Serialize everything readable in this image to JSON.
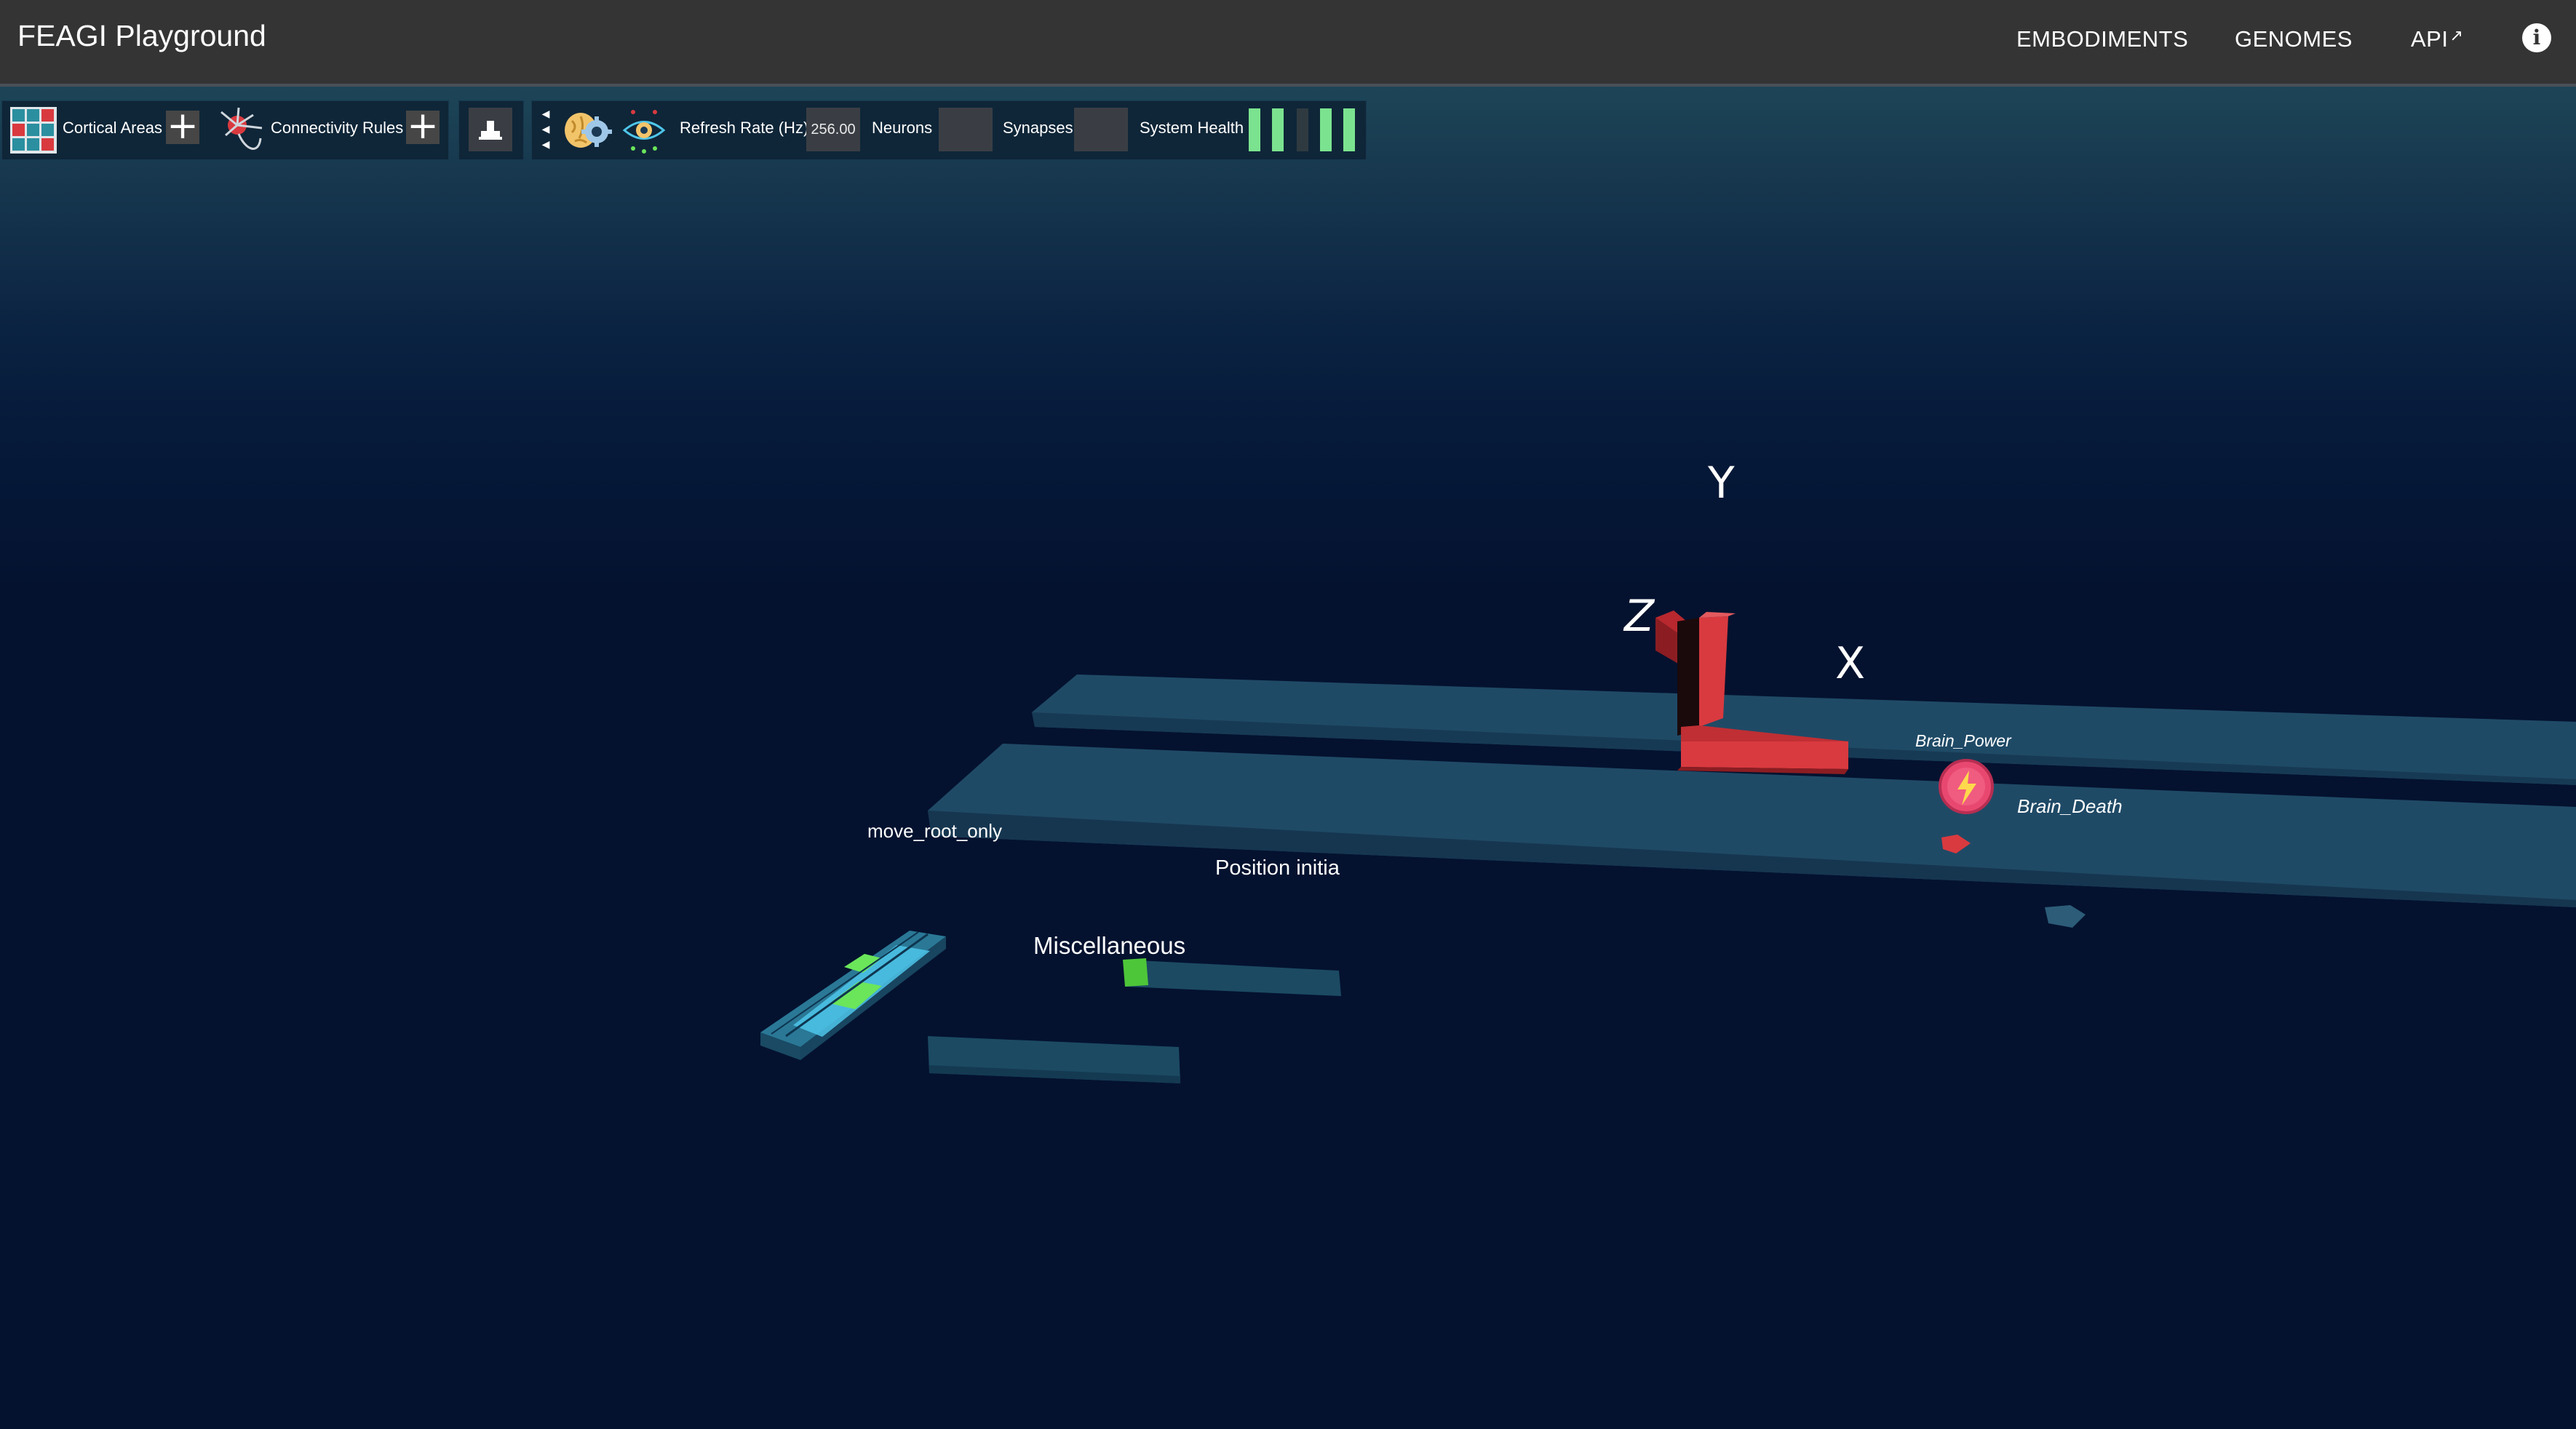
{
  "app": {
    "title": "FEAGI Playground"
  },
  "nav": {
    "embodiments": "EMBODIMENTS",
    "genomes": "GENOMES",
    "api": "API",
    "info_icon": "info-icon"
  },
  "toolbar": {
    "cortical_areas_label": "Cortical Areas",
    "connectivity_rules_label": "Connectivity Rules",
    "refresh_rate_label": "Refresh Rate (Hz)",
    "refresh_rate_value": "256.00",
    "neurons_label": "Neurons",
    "neurons_value": "",
    "synapses_label": "Synapses",
    "synapses_value": "",
    "system_health_label": "System Health",
    "system_health_bars": [
      "on",
      "on",
      "off",
      "on",
      "on"
    ],
    "icons": [
      "cortical-grid-icon",
      "plus-icon",
      "neuron-icon",
      "plus-icon",
      "circuit-icon",
      "collapse-arrows-icon",
      "brain-gear-icon",
      "eye-icon"
    ]
  },
  "scene": {
    "axes": {
      "x": "X",
      "y": "Y",
      "z": "Z"
    },
    "labels": {
      "brain_power": "Brain_Power",
      "brain_death": "Brain_Death",
      "move_root_only": "move_root_only",
      "position_initia": "Position initia",
      "miscellaneous": "Miscellaneous"
    }
  },
  "colors": {
    "appbar": "#343434",
    "scene_bg": "#04122f",
    "axis_red": "#d93a3f",
    "health_green": "#7be38f",
    "active_neuron": "#6be65a",
    "voxel_cyan": "#4ec6ea",
    "plate": "#1f4a66"
  }
}
